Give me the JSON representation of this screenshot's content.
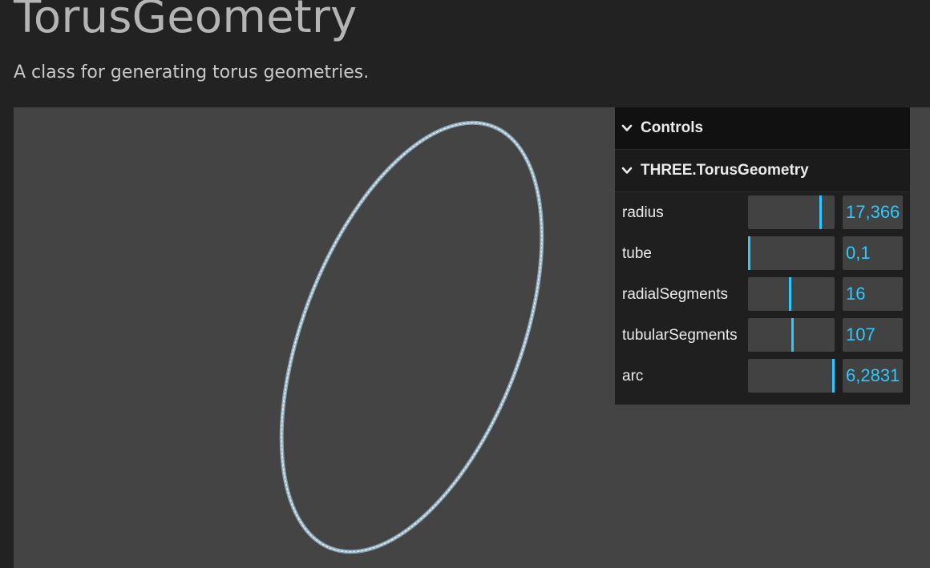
{
  "page": {
    "title": "TorusGeometry",
    "subtitle": "A class for generating torus geometries."
  },
  "colors": {
    "page_background": "#222222",
    "viewport_background": "#444444",
    "torus_stroke": "#c9dbe6",
    "gui_background": "#1f1f1f",
    "gui_header_background": "#111111",
    "accent": "#2cc9ff"
  },
  "gui": {
    "header_label": "Controls",
    "header_icon": "chevron-down-icon",
    "folder": {
      "label": "THREE.TorusGeometry",
      "icon": "chevron-down-icon"
    },
    "controls": [
      {
        "label": "radius",
        "value": "17,366",
        "level": 0.85
      },
      {
        "label": "tube",
        "value": "0,1",
        "level": 0.0
      },
      {
        "label": "radialSegments",
        "value": "16",
        "level": 0.5
      },
      {
        "label": "tubularSegments",
        "value": "107",
        "level": 0.53
      },
      {
        "label": "arc",
        "value": "6,2831",
        "level": 1.0
      }
    ]
  }
}
